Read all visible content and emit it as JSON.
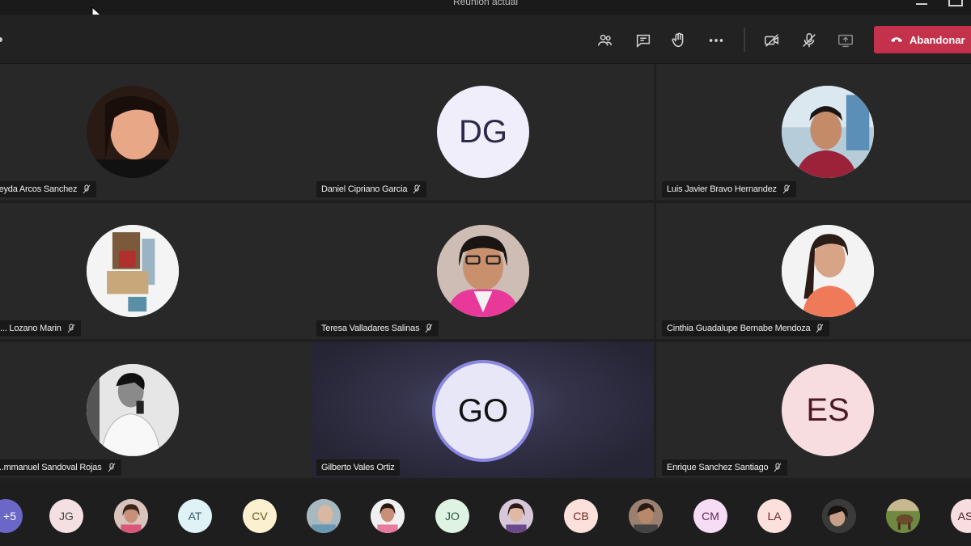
{
  "window": {
    "title": "Reunión actual"
  },
  "toolbar": {
    "leave_label": "Abandonar",
    "leave_color": "#c4314b",
    "icons": [
      "participants-icon",
      "chat-icon",
      "raise-hand-icon",
      "more-icon",
      "camera-off-icon",
      "mic-off-icon",
      "share-screen-icon"
    ]
  },
  "participants": [
    {
      "name": "...eyda Arcos Sanchez",
      "muted": true
    },
    {
      "name": "Daniel Cipriano Garcia",
      "initials": "DG",
      "muted": true
    },
    {
      "name": "Luis Javier Bravo Hernandez",
      "muted": true
    },
    {
      "name": "... Lozano Marin",
      "muted": true
    },
    {
      "name": "Teresa Valladares Salinas",
      "muted": true
    },
    {
      "name": "Cinthia Guadalupe Bernabe Mendoza",
      "muted": true
    },
    {
      "name": "...mmanuel Sandoval Rojas",
      "muted": true
    },
    {
      "name": "Gilberto Vales Ortiz",
      "initials": "GO",
      "muted": false,
      "speaking": true
    },
    {
      "name": "Enrique Sanchez Santiago",
      "initials": "ES",
      "muted": true
    }
  ],
  "strip": {
    "overflow_label": "+5",
    "items": [
      "JG",
      "",
      "AT",
      "CV",
      "",
      "",
      "JO",
      "",
      "CB",
      "",
      "CM",
      "LA",
      "",
      "",
      "AS"
    ]
  }
}
